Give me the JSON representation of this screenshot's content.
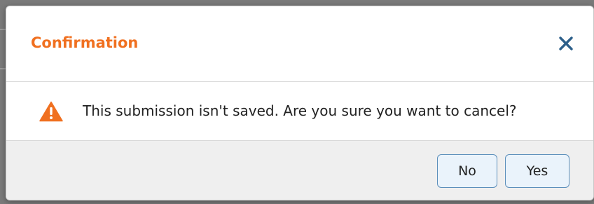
{
  "dialog": {
    "title": "Confirmation",
    "close_icon": "close-icon",
    "warning_icon": "warning-triangle-icon",
    "message": "This submission isn't saved. Are you sure you want to cancel?",
    "buttons": {
      "no_label": "No",
      "yes_label": "Yes"
    }
  },
  "colors": {
    "title": "#f07020",
    "warning": "#f07020",
    "close": "#2c5f8a",
    "button_border": "#5c8fbb",
    "button_bg": "#eaf3fb",
    "footer_bg": "#efefef"
  }
}
